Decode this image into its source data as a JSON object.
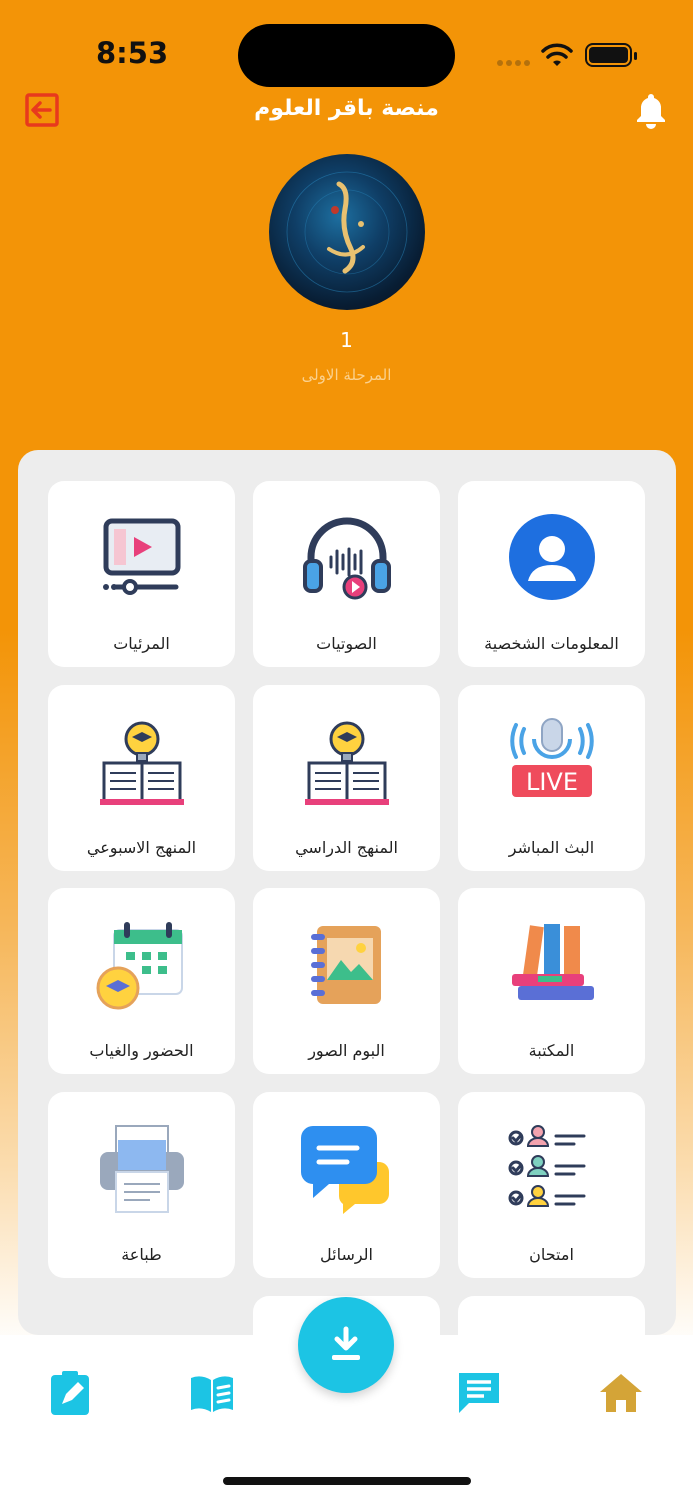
{
  "status": {
    "time": "8:53"
  },
  "header": {
    "title": "منصة باقر العلوم"
  },
  "user": {
    "number": "1",
    "stage": "المرحلة الاولى"
  },
  "tiles": [
    {
      "label": "المعلومات الشخصية",
      "icon": "person-icon"
    },
    {
      "label": "الصوتيات",
      "icon": "headphones-icon"
    },
    {
      "label": "المرئيات",
      "icon": "video-player-icon"
    },
    {
      "label": "البث المباشر",
      "icon": "live-microphone-icon"
    },
    {
      "label": "المنهج الدراسي",
      "icon": "book-lightbulb-icon"
    },
    {
      "label": "المنهج الاسبوعي",
      "icon": "book-lightbulb-icon"
    },
    {
      "label": "المكتبة",
      "icon": "books-stack-icon"
    },
    {
      "label": "البوم الصور",
      "icon": "photo-album-icon"
    },
    {
      "label": "الحضور والغياب",
      "icon": "calendar-graduation-icon"
    },
    {
      "label": "امتحان",
      "icon": "checklist-icon"
    },
    {
      "label": "الرسائل",
      "icon": "chat-bubbles-icon"
    },
    {
      "label": "طباعة",
      "icon": "printer-icon"
    }
  ],
  "colors": {
    "primary": "#F39407",
    "accent": "#1CC4E4",
    "home": "#D4A437"
  }
}
